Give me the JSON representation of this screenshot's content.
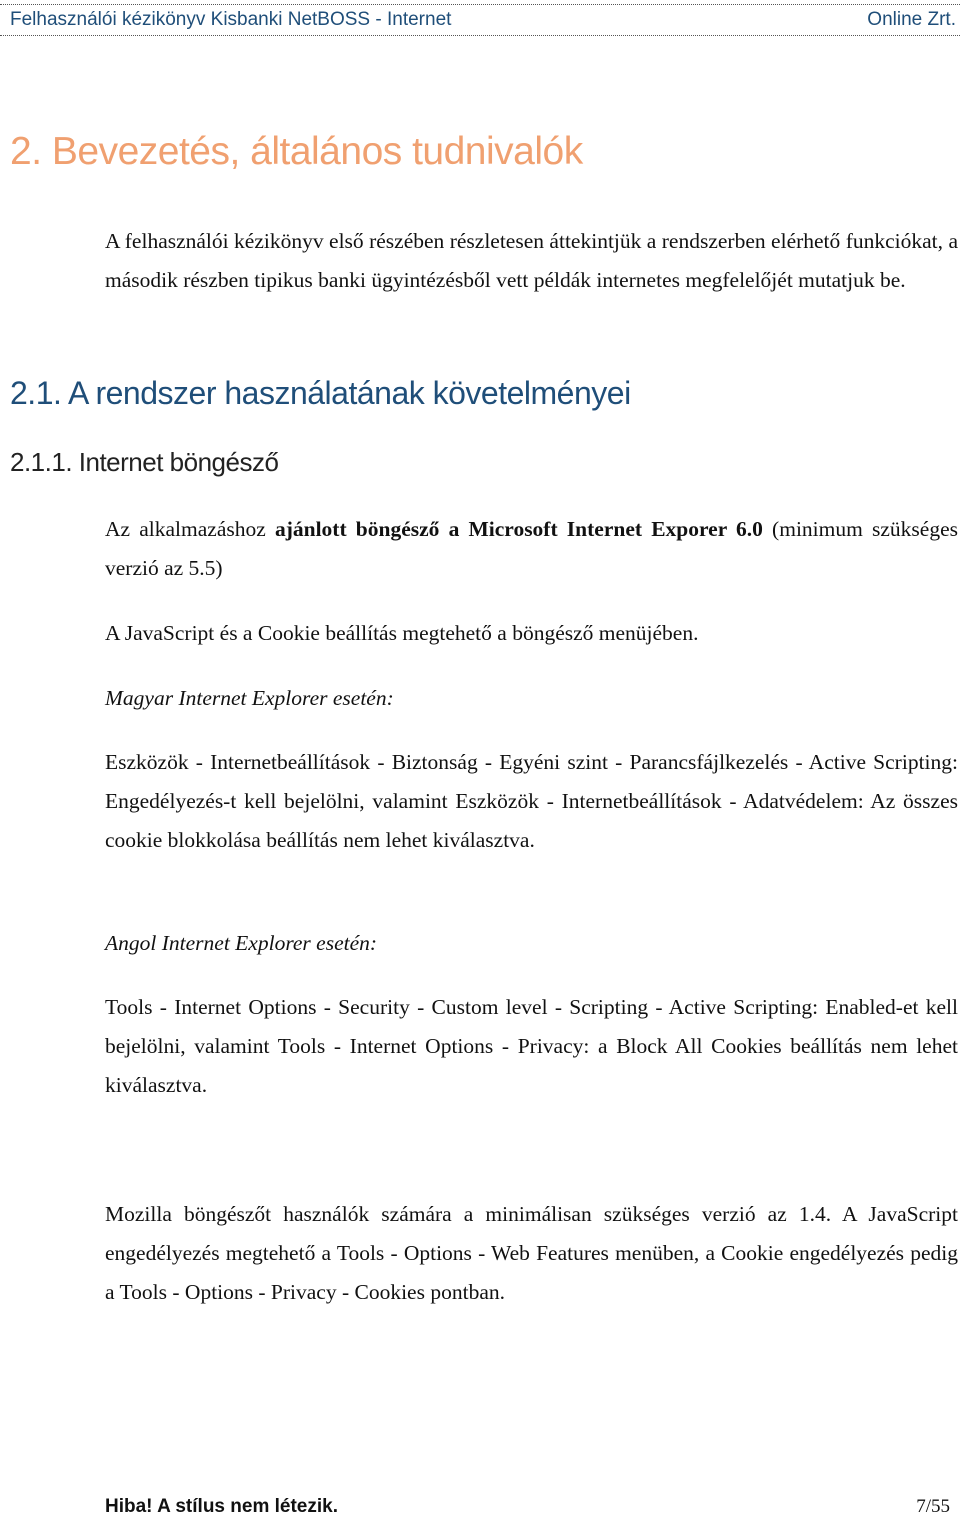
{
  "header": {
    "left": "Felhasználói kézikönyv Kisbanki NetBOSS - Internet",
    "right": "Online Zrt."
  },
  "section": {
    "title": "2. Bevezetés, általános tudnivalók",
    "intro": "A felhasználói kézikönyv első részében részletesen áttekintjük a rendszerben elérhető funkciókat, a második részben tipikus banki ügyintézésből vett példák internetes megfelelőjét mutatjuk be."
  },
  "subsection": {
    "title": "2.1. A rendszer használatának követelményei"
  },
  "subsubsection": {
    "title": "2.1.1. Internet böngésző",
    "p1_prefix": "Az alkalmazáshoz ",
    "p1_bold": "ajánlott böngésző a Microsoft Internet Exporer 6.0",
    "p1_suffix": " (minimum szükséges verzió az 5.5)",
    "p2": "A JavaScript és a Cookie beállítás megtehető a böngésző menüjében.",
    "hu_label": "Magyar Internet Explorer esetén:",
    "hu_text": "Eszközök - Internetbeállítások - Biztonság - Egyéni szint - Parancsfájlkezelés - Active Scripting: Engedélyezés-t kell bejelölni, valamint Eszközök - Internetbeállítások - Adatvédelem: Az összes cookie blokkolása beállítás nem lehet kiválasztva.",
    "en_label": "Angol Internet Explorer esetén:",
    "en_text": "Tools - Internet Options - Security - Custom level - Scripting - Active Scripting: Enabled-et kell bejelölni, valamint Tools - Internet Options - Privacy: a Block All Cookies beállítás nem lehet kiválasztva.",
    "mozilla_text": "Mozilla böngészőt használók számára a minimálisan szükséges verzió az 1.4. A JavaScript engedélyezés megtehető a Tools - Options - Web Features menüben, a Cookie engedélyezés pedig a Tools - Options - Privacy - Cookies pontban."
  },
  "footer": {
    "left": "Hiba! A stílus nem létezik.",
    "page": "7/55"
  }
}
